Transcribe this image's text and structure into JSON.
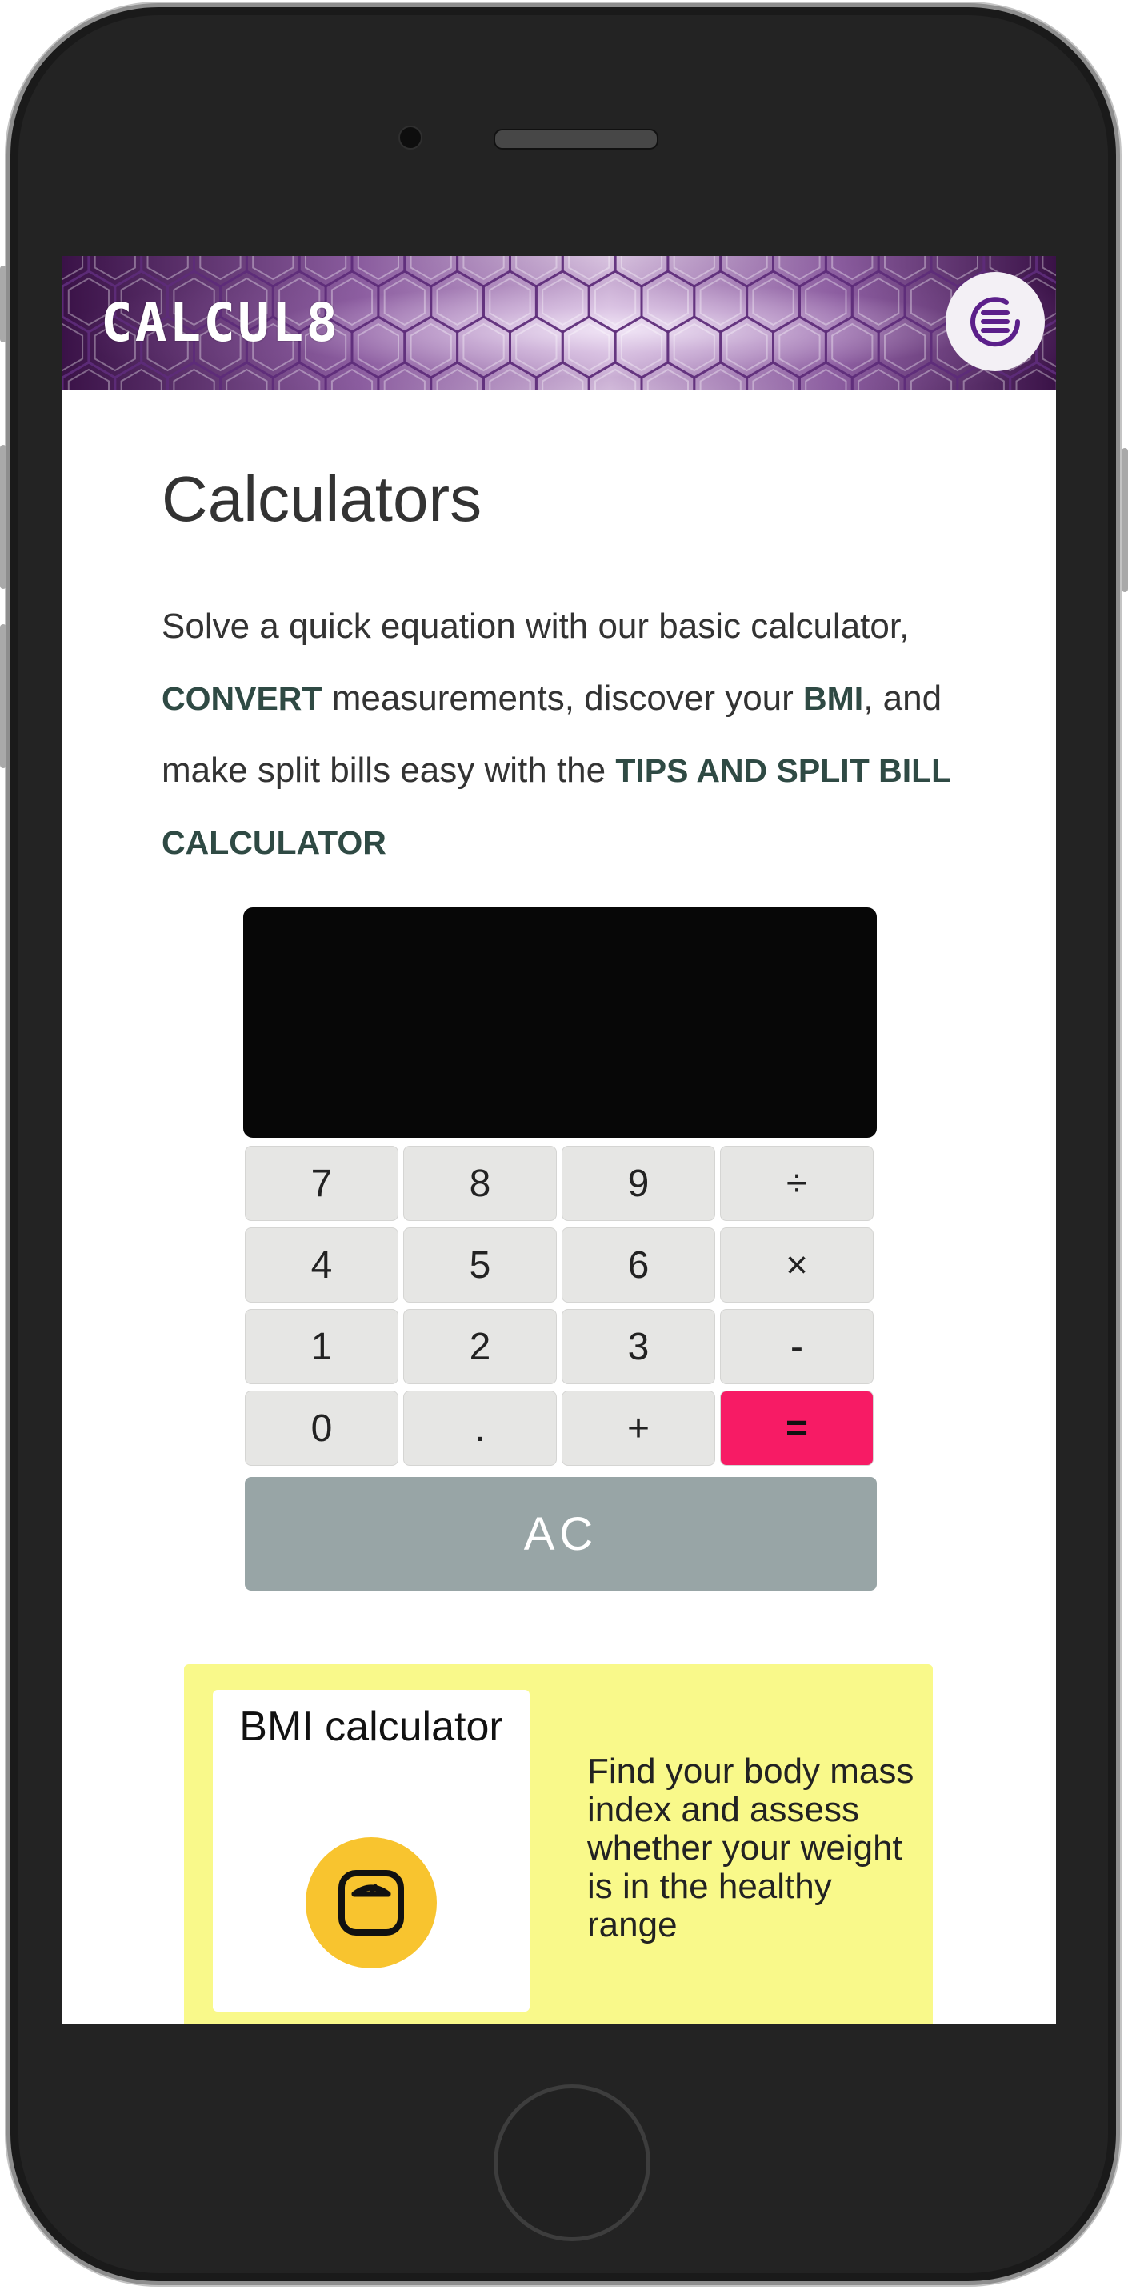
{
  "app": {
    "logo": "CALCUL8"
  },
  "header": {
    "menu_icon": "menu-lines-icon"
  },
  "page": {
    "title": "Calculators",
    "intro": {
      "part1": "Solve a quick equation with our basic calculator, ",
      "convert_link": "CONVERT",
      "part2": " measurements, discover your ",
      "bmi_link": "BMI",
      "part3": ", and make split bills easy with the ",
      "tips_link": "TIPS AND SPLIT BILL CALCULATOR"
    }
  },
  "calculator": {
    "display_value": "",
    "keys": [
      "7",
      "8",
      "9",
      "÷",
      "4",
      "5",
      "6",
      "×",
      "1",
      "2",
      "3",
      "-",
      "0",
      ".",
      "+",
      "="
    ],
    "clear_label": "AC"
  },
  "bmi_card": {
    "title": "BMI calculator",
    "description": "Find your body mass index and assess whether your weight is in the healthy range",
    "icon": "weighing-scale-icon"
  },
  "colors": {
    "header_purple": "#7a4c8e",
    "equals_key": "#f71b65",
    "clear_key": "#98a5a6",
    "bmi_card_bg": "#f9f98a",
    "bmi_icon_bg": "#f8c42f",
    "keyword": "#2f4a44"
  }
}
